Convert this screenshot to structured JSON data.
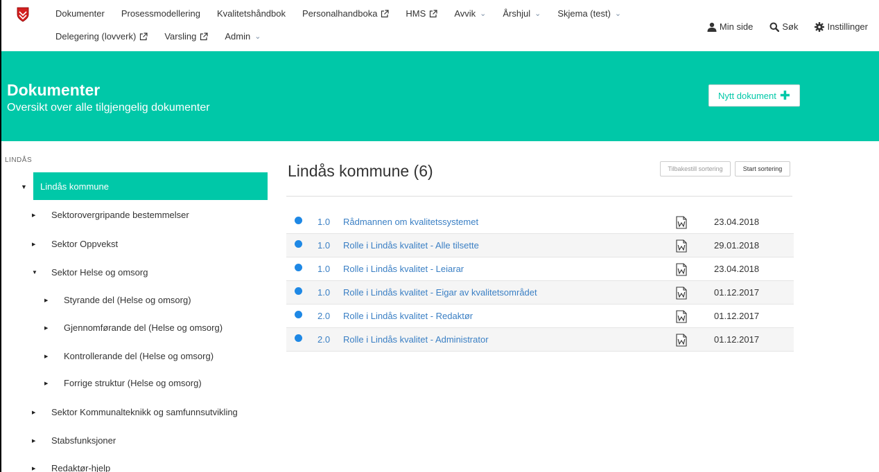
{
  "nav": {
    "row1": [
      {
        "label": "Dokumenter",
        "kind": "plain"
      },
      {
        "label": "Prosessmodellering",
        "kind": "plain"
      },
      {
        "label": "Kvalitetshåndbok",
        "kind": "plain"
      },
      {
        "label": "Personalhandboka",
        "kind": "external"
      },
      {
        "label": "HMS",
        "kind": "external"
      },
      {
        "label": "Avvik",
        "kind": "dropdown"
      },
      {
        "label": "Årshjul",
        "kind": "dropdown"
      },
      {
        "label": "Skjema (test)",
        "kind": "dropdown"
      }
    ],
    "row2": [
      {
        "label": "Delegering (lovverk)",
        "kind": "external"
      },
      {
        "label": "Varsling",
        "kind": "external"
      },
      {
        "label": "Admin",
        "kind": "dropdown"
      }
    ],
    "right": {
      "my_page": "Min side",
      "search": "Søk",
      "settings": "Instillinger"
    }
  },
  "hero": {
    "title": "Dokumenter",
    "subtitle": "Oversikt over alle tilgjengelig dokumenter",
    "new_doc_label": "Nytt dokument"
  },
  "sidebar": {
    "heading": "LINDÅS",
    "items": [
      {
        "label": "Lindås kommune",
        "level": 0,
        "expanded": true,
        "active": true
      },
      {
        "label": "Sektorovergripande bestemmelser",
        "level": 1,
        "expanded": false
      },
      {
        "label": "Sektor Oppvekst",
        "level": 1,
        "expanded": false
      },
      {
        "label": "Sektor Helse og omsorg",
        "level": 1,
        "expanded": true
      },
      {
        "label": "Styrande del (Helse og omsorg)",
        "level": 2,
        "expanded": false
      },
      {
        "label": "Gjennomførande del (Helse og omsorg)",
        "level": 2,
        "expanded": false
      },
      {
        "label": "Kontrollerande del (Helse og omsorg)",
        "level": 2,
        "expanded": false
      },
      {
        "label": "Forrige struktur (Helse og omsorg)",
        "level": 2,
        "expanded": false
      },
      {
        "label": "Sektor Kommunalteknikk og samfunnsutvikling",
        "level": 1,
        "expanded": false
      },
      {
        "label": "Stabsfunksjoner",
        "level": 1,
        "expanded": false
      },
      {
        "label": "Redaktør-hjelp",
        "level": 1,
        "expanded": false
      }
    ]
  },
  "main": {
    "title": "Lindås kommune (6)",
    "reset_sort_label": "Tilbakestill sortering",
    "start_sort_label": "Start sortering",
    "documents": [
      {
        "version": "1.0",
        "title": "Rådmannen om kvalitetssystemet",
        "date": "23.04.2018",
        "file_type": "word-icon"
      },
      {
        "version": "1.0",
        "title": "Rolle i Lindås kvalitet - Alle tilsette",
        "date": "29.01.2018",
        "file_type": "word-icon"
      },
      {
        "version": "1.0",
        "title": "Rolle i Lindås kvalitet - Leiarar",
        "date": "23.04.2018",
        "file_type": "word-icon"
      },
      {
        "version": "1.0",
        "title": "Rolle i Lindås kvalitet - Eigar av kvalitetsområdet",
        "date": "01.12.2017",
        "file_type": "word-icon"
      },
      {
        "version": "2.0",
        "title": "Rolle i Lindås kvalitet - Redaktør",
        "date": "01.12.2017",
        "file_type": "word-icon"
      },
      {
        "version": "2.0",
        "title": "Rolle i Lindås kvalitet - Administrator",
        "date": "01.12.2017",
        "file_type": "word-icon"
      }
    ]
  },
  "colors": {
    "accent": "#00c8a8",
    "link": "#3a7fc4",
    "status_dot": "#1e88e5"
  }
}
